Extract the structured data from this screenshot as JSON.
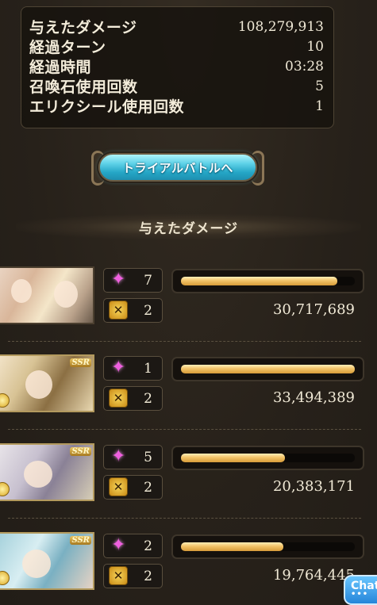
{
  "stats": [
    {
      "label": "与えたダメージ",
      "value": "108,279,913"
    },
    {
      "label": "経過ターン",
      "value": "10"
    },
    {
      "label": "経過時間",
      "value": "03:28"
    },
    {
      "label": "召喚石使用回数",
      "value": "5"
    },
    {
      "label": "エリクシール使用回数",
      "value": "1"
    }
  ],
  "trial_button_label": "トライアルバトルへ",
  "section_title": "与えたダメージ",
  "characters": [
    {
      "ssr": "",
      "skills": "7",
      "attacks": "2",
      "gauge_percent": 90,
      "damage": "30,717,689"
    },
    {
      "ssr": "SSR",
      "skills": "1",
      "attacks": "2",
      "gauge_percent": 100,
      "damage": "33,494,389"
    },
    {
      "ssr": "SSR",
      "skills": "5",
      "attacks": "2",
      "gauge_percent": 60,
      "damage": "20,383,171"
    },
    {
      "ssr": "SSR",
      "skills": "2",
      "attacks": "2",
      "gauge_percent": 59,
      "damage": "19,764,445"
    }
  ],
  "chat_label": "Chat",
  "icons": {
    "skill": "sparkle-icon",
    "attack": "crossed-swords-icon"
  },
  "colors": {
    "gauge": "#f2c368",
    "trial_button": "#5fd2e8",
    "skill_icon": "#f05fe0"
  }
}
